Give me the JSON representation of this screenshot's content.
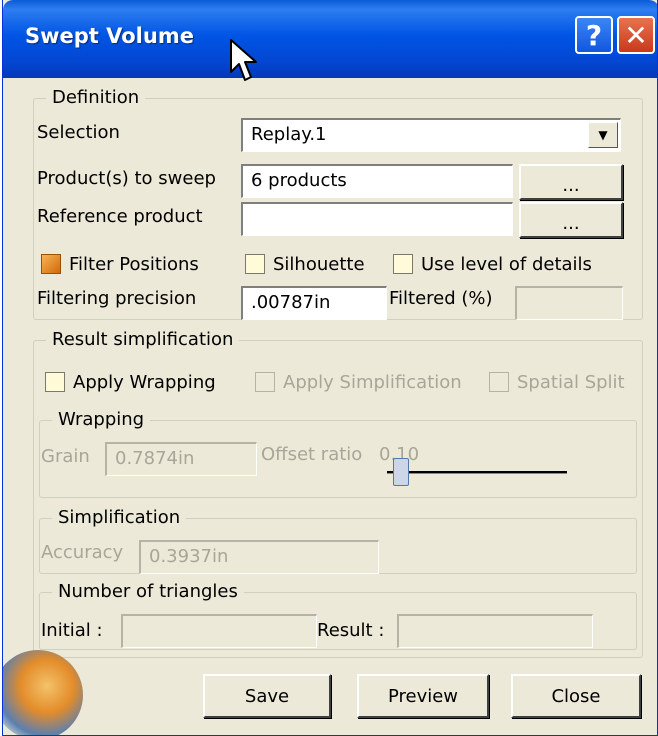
{
  "window": {
    "title": "Swept Volume",
    "help_label": "?",
    "close_label": "✕"
  },
  "definition": {
    "legend": "Definition",
    "selection_label": "Selection",
    "selection_value": "Replay.1",
    "products_label": "Product(s) to sweep",
    "products_value": "6 products",
    "products_browse": "...",
    "reference_label": "Reference product",
    "reference_value": "",
    "reference_browse": "...",
    "filter_positions_label": "Filter Positions",
    "filter_positions_checked": true,
    "silhouette_label": "Silhouette",
    "silhouette_checked": false,
    "level_of_details_label": "Use level of details",
    "level_of_details_checked": false,
    "filtering_precision_label": "Filtering precision",
    "filtering_precision_value": ".00787in",
    "filtered_label": "Filtered (%)",
    "filtered_value": ""
  },
  "result": {
    "legend": "Result simplification",
    "apply_wrapping_label": "Apply Wrapping",
    "apply_simplification_label": "Apply Simplification",
    "spatial_split_label": "Spatial Split",
    "wrapping": {
      "legend": "Wrapping",
      "grain_label": "Grain",
      "grain_value": "0.7874in",
      "offset_ratio_label": "Offset ratio",
      "offset_ratio_value": "0.10",
      "offset_ratio_slider_fraction": 0.1
    },
    "simplification": {
      "legend": "Simplification",
      "accuracy_label": "Accuracy",
      "accuracy_value": "0.3937in"
    },
    "triangles": {
      "legend": "Number of triangles",
      "initial_label": "Initial :",
      "initial_value": "",
      "result_label": "Result :",
      "result_value": ""
    }
  },
  "buttons": {
    "save": "Save",
    "preview": "Preview",
    "close": "Close"
  },
  "icons": [
    "help-icon",
    "close-icon",
    "mouse-cursor-icon",
    "dropdown-arrow-icon",
    "app-logo"
  ]
}
